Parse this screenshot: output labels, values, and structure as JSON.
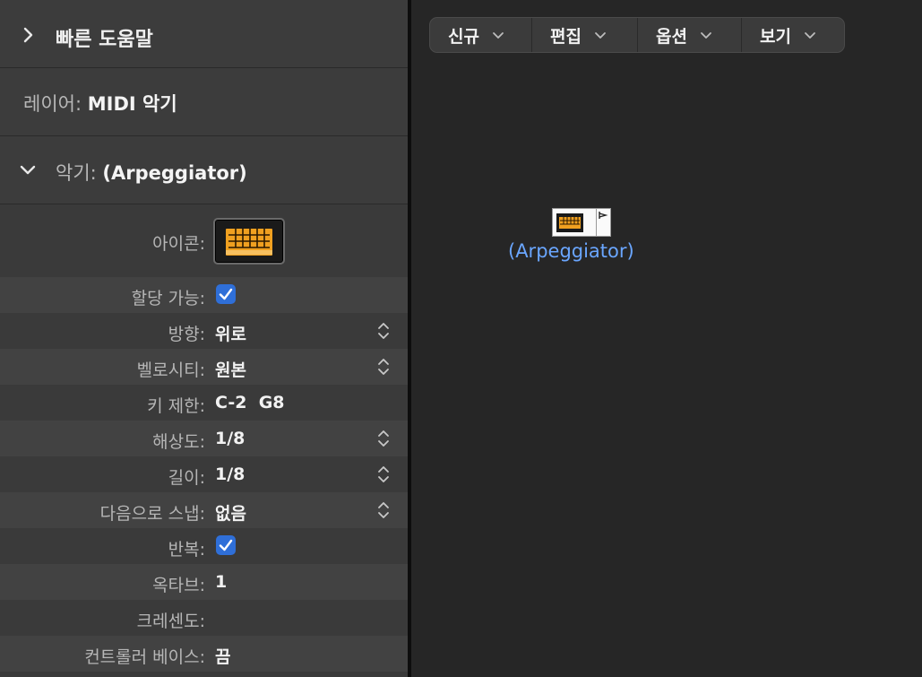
{
  "inspector": {
    "quick_help": {
      "title": "빠른 도움말"
    },
    "layer": {
      "label": "레이어:",
      "value": "MIDI 악기"
    },
    "instrument": {
      "label": "악기:",
      "value": "(Arpeggiator)"
    },
    "params": [
      {
        "label": "아이콘:",
        "type": "icon"
      },
      {
        "label": "할당 가능:",
        "type": "check",
        "checked": true
      },
      {
        "label": "방향:",
        "value": "위로",
        "type": "popup"
      },
      {
        "label": "벨로시티:",
        "value": "원본",
        "type": "popup"
      },
      {
        "label": "키 제한:",
        "value": "C-2  G8",
        "type": "text"
      },
      {
        "label": "해상도:",
        "value": "1/8",
        "type": "popup"
      },
      {
        "label": "길이:",
        "value": "1/8",
        "type": "popup"
      },
      {
        "label": "다음으로 스냅:",
        "value": "없음",
        "type": "popup"
      },
      {
        "label": "반복:",
        "type": "check",
        "checked": true
      },
      {
        "label": "옥타브:",
        "value": "1",
        "type": "text"
      },
      {
        "label": "크레센도:",
        "value": "",
        "type": "text"
      },
      {
        "label": "컨트롤러 베이스:",
        "value": "끔",
        "type": "text"
      }
    ]
  },
  "menubar": {
    "new": "신규",
    "edit": "편집",
    "options": "옵션",
    "view": "보기"
  },
  "object": {
    "name": "(Arpeggiator)",
    "icon": "keyboard-icon"
  },
  "colors": {
    "accent": "#2f6fd8",
    "object_label": "#6aa6ff",
    "icon_amber": "#f0a020"
  }
}
